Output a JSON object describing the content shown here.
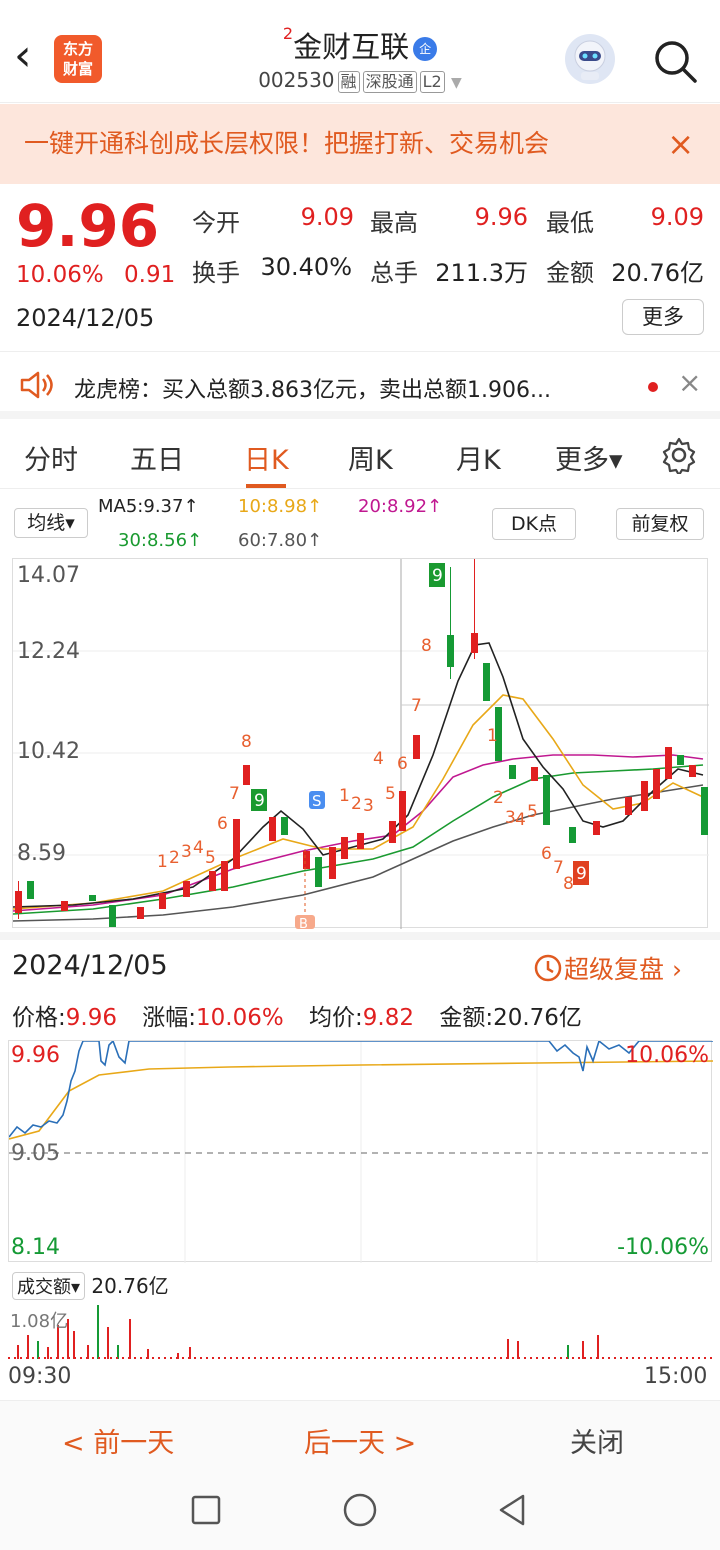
{
  "header": {
    "back_icon": "back-chevron-icon",
    "logo_line1": "东方",
    "logo_line2": "财富",
    "stock_superscript": "2",
    "stock_name": "金财互联",
    "enterprise_badge": "企",
    "stock_code": "002530",
    "tags": [
      "融",
      "深股通",
      "L2"
    ],
    "search_icon": "search-icon",
    "assistant_icon": "robot-avatar-icon"
  },
  "banner": {
    "text": "一键开通科创成长层权限！把握打新、交易机会",
    "close": "×"
  },
  "quote": {
    "price": "9.96",
    "change_pct": "10.06%",
    "change": "0.91",
    "date": "2024/12/05",
    "open_label": "今开",
    "open": "9.09",
    "high_label": "最高",
    "high": "9.96",
    "low_label": "最低",
    "low": "9.09",
    "turnover_label": "换手",
    "turnover": "30.40%",
    "volume_label": "总手",
    "volume": "211.3万",
    "amount_label": "金额",
    "amount": "20.76亿",
    "more": "更多"
  },
  "notice": {
    "icon": "speaker-icon",
    "text": "龙虎榜：买入总额3.863亿元，卖出总额1.906...",
    "close": "×"
  },
  "tabs": [
    "分时",
    "五日",
    "日K",
    "周K",
    "月K",
    "更多▾"
  ],
  "active_tab": "日K",
  "settings_icon": "gear-icon",
  "kline": {
    "ma_selector": "均线▾",
    "ma5": "MA5:9.37↑",
    "ma10": "10:8.98↑",
    "ma20": "20:8.92↑",
    "ma30": "30:8.56↑",
    "ma60": "60:7.80↑",
    "dk_button": "DK点",
    "adjust_button": "前复权",
    "y_ticks": [
      "14.07",
      "12.24",
      "10.42",
      "8.59"
    ],
    "signal_b": "B",
    "signal_s": "S",
    "colors": {
      "ma5": "#222222",
      "ma10": "#e8a818",
      "ma20": "#c01890",
      "ma30": "#1a9a30",
      "ma60": "#555555",
      "up": "#e02020",
      "down": "#159a35"
    }
  },
  "intraday": {
    "date": "2024/12/05",
    "replay": "超级复盘",
    "price_label": "价格:",
    "price": "9.96",
    "chg_label": "涨幅:",
    "chg": "10.06%",
    "avg_label": "均价:",
    "avg": "9.82",
    "amt_label": "金额:",
    "amt": "20.76亿",
    "y_top": "9.96",
    "y_mid": "9.05",
    "y_bot": "8.14",
    "pct_top": "10.06%",
    "pct_bot": "-10.06%",
    "vol_selector": "成交额▾",
    "vol_total": "20.76亿",
    "vol_max": "1.08亿",
    "t_start": "09:30",
    "t_end": "15:00"
  },
  "footer": {
    "prev": "< 前一天",
    "next": "后一天 >",
    "close": "关闭"
  }
}
